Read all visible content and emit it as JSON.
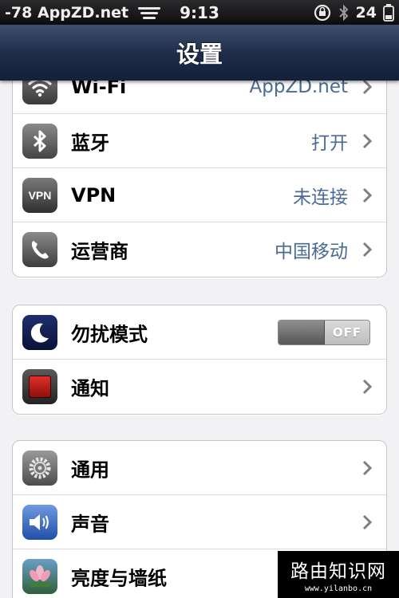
{
  "status_bar": {
    "carrier": "-78 AppZD.net",
    "time": "9:13",
    "battery": "24"
  },
  "nav": {
    "title": "设置"
  },
  "groups": [
    {
      "rows": [
        {
          "label": "Wi-Fi",
          "value": "AppZD.net",
          "icon": "wifi-icon"
        },
        {
          "label": "蓝牙",
          "value": "打开",
          "icon": "bluetooth-icon"
        },
        {
          "label": "VPN",
          "value": "未连接",
          "icon": "vpn-icon",
          "icon_text": "VPN"
        },
        {
          "label": "运营商",
          "value": "中国移动",
          "icon": "phone-icon"
        }
      ]
    },
    {
      "rows": [
        {
          "label": "勿扰模式",
          "toggle": "OFF",
          "toggle_state": false,
          "icon": "moon-icon"
        },
        {
          "label": "通知",
          "icon": "notifications-icon"
        }
      ]
    },
    {
      "rows": [
        {
          "label": "通用",
          "icon": "gear-icon"
        },
        {
          "label": "声音",
          "icon": "speaker-icon"
        },
        {
          "label": "亮度与墙纸",
          "icon": "flower-icon"
        }
      ]
    }
  ],
  "watermark": {
    "title": "路由知识网",
    "url": "www.yilanbo.cn"
  },
  "colors": {
    "value_text": "#4a6b94",
    "nav_bar": "#1f2d49"
  }
}
